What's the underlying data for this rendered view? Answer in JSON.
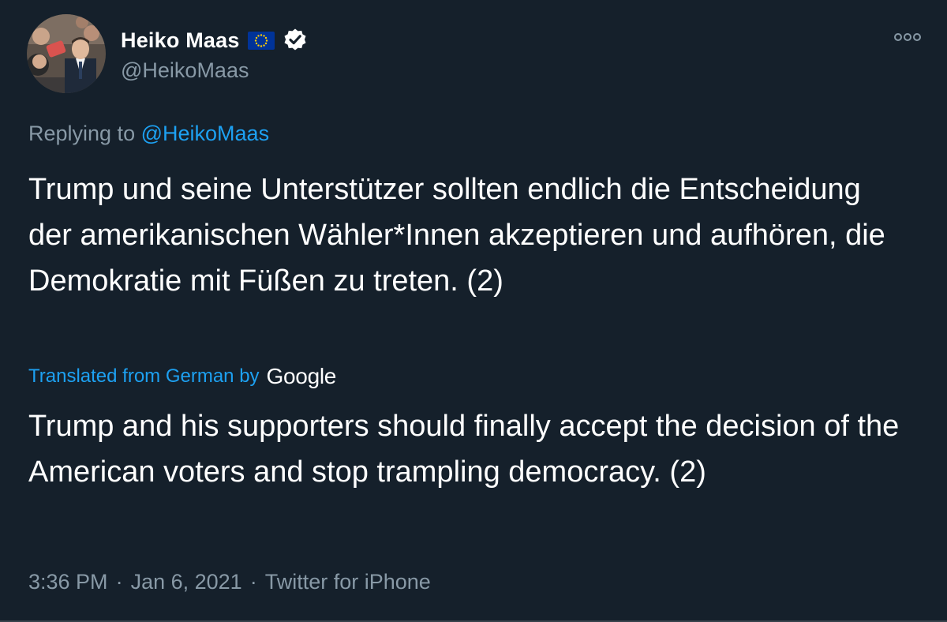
{
  "author": {
    "display_name": "Heiko Maas",
    "handle": "@HeikoMaas",
    "flag_icon": "eu-flag-icon",
    "verified_icon": "verified-badge-icon"
  },
  "more_icon": "more-options-icon",
  "reply": {
    "prefix": "Replying to",
    "mention": "@HeikoMaas"
  },
  "text_original": "Trump und seine Unterstützer sollten endlich die Entscheidung der amerikanischen Wähler*Innen akzeptieren und aufhören, die Demokratie mit Füßen zu treten. (2)",
  "translation": {
    "label": "Translated from German by",
    "provider": "Google",
    "text": "Trump and his supporters should finally accept the decision of the American voters and stop trampling democracy. (2)"
  },
  "meta": {
    "time": "3:36 PM",
    "separator": "·",
    "date": "Jan 6, 2021",
    "source": "Twitter for iPhone"
  },
  "colors": {
    "background": "#15202b",
    "primary_text": "#ffffff",
    "secondary_text": "#8899a6",
    "accent": "#1da1f2",
    "eu_blue": "#003399",
    "eu_star": "#ffcc00"
  }
}
